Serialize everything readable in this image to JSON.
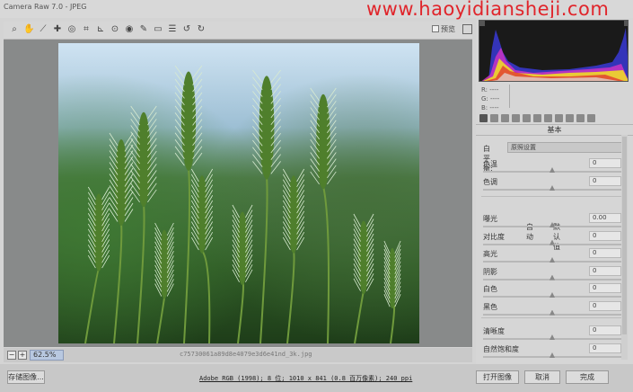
{
  "window": {
    "title": "Camera Raw 7.0 - JPEG"
  },
  "watermark": "www.haoyidiansheji.com",
  "toolbar": {
    "tools": [
      "zoom-icon",
      "hand-icon",
      "white-balance-icon",
      "color-sampler-icon",
      "target-adjust-icon",
      "crop-icon",
      "straighten-icon",
      "spot-removal-icon",
      "red-eye-icon",
      "adjustment-brush-icon",
      "graduated-filter-icon",
      "open-preferences-icon",
      "rotate-ccw-icon",
      "rotate-cw-icon"
    ],
    "preview_label": "预览"
  },
  "status": {
    "zoom_value": "62.5%",
    "filename": "c75730061a89d8e4079e3d6e41nd_3k.jpg"
  },
  "histogram": {
    "r_label": "R:",
    "g_label": "G:",
    "b_label": "B:",
    "r_value": "----",
    "g_value": "----",
    "b_value": "----"
  },
  "panel": {
    "title": "基本",
    "white_balance": {
      "label": "白平衡:",
      "value": "原照设置"
    },
    "auto_label": "自动",
    "default_label": "默认值",
    "sliders_wb": [
      {
        "label": "色温",
        "value": "0",
        "pos": 0.5
      },
      {
        "label": "色调",
        "value": "0",
        "pos": 0.5
      }
    ],
    "sliders_tone": [
      {
        "label": "曝光",
        "value": "0.00",
        "pos": 0.5
      },
      {
        "label": "对比度",
        "value": "0",
        "pos": 0.5
      },
      {
        "label": "高光",
        "value": "0",
        "pos": 0.5
      },
      {
        "label": "阴影",
        "value": "0",
        "pos": 0.5
      },
      {
        "label": "白色",
        "value": "0",
        "pos": 0.5
      },
      {
        "label": "黑色",
        "value": "0",
        "pos": 0.5
      }
    ],
    "sliders_presence": [
      {
        "label": "清晰度",
        "value": "0",
        "pos": 0.5
      },
      {
        "label": "自然饱和度",
        "value": "0",
        "pos": 0.5
      }
    ]
  },
  "bottom": {
    "save_label": "存储图像...",
    "info_text": "Adobe RGB (1998); 8 位; 1010 x 841 (0.8 百万像素); 240 ppi",
    "open_label": "打开图像",
    "cancel_label": "取消",
    "done_label": "完成"
  }
}
